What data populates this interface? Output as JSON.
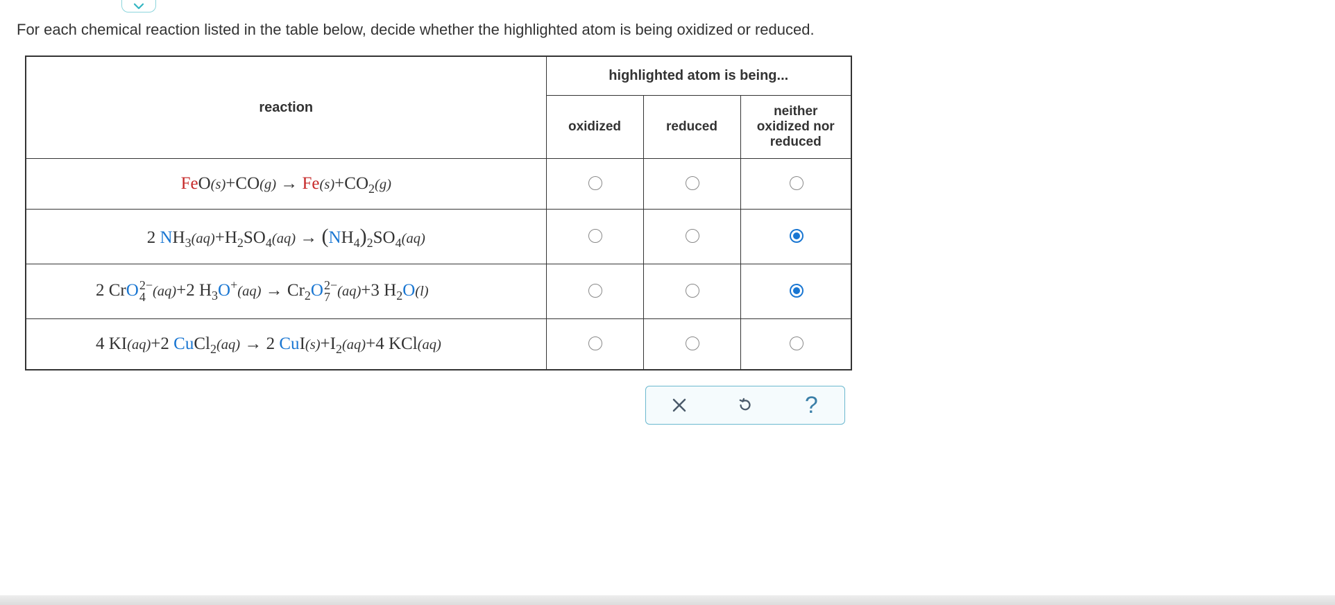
{
  "prompt": "For each chemical reaction listed in the table below, decide whether the highlighted atom is being oxidized or reduced.",
  "headers": {
    "reaction": "reaction",
    "group": "highlighted atom is being...",
    "oxidized": "oxidized",
    "reduced": "reduced",
    "neither": "neither oxidized nor reduced"
  },
  "reactions": [
    {
      "row": 1,
      "highlight_color": "red",
      "highlighted_atom": "Fe",
      "formula_text": "FeO(s)+CO(g) → Fe(s)+CO2(g)",
      "selected": null
    },
    {
      "row": 2,
      "highlight_color": "blue",
      "highlighted_atom": "N",
      "formula_text": "2 NH3(aq)+H2SO4(aq) → (NH4)2SO4(aq)",
      "selected": "neither"
    },
    {
      "row": 3,
      "highlight_color": "blue",
      "highlighted_atom": "O",
      "formula_text": "2 CrO4^2-(aq)+2 H3O+(aq) → Cr2O7^2-(aq)+3 H2O(l)",
      "selected": "neither"
    },
    {
      "row": 4,
      "highlight_color": "blue",
      "highlighted_atom": "Cu",
      "formula_text": "4 KI(aq)+2 CuCl2(aq) → 2 CuI(s)+I2(aq)+4 KCl(aq)",
      "selected": null
    }
  ],
  "actions": {
    "clear": "×",
    "reset": "↺",
    "help": "?"
  }
}
